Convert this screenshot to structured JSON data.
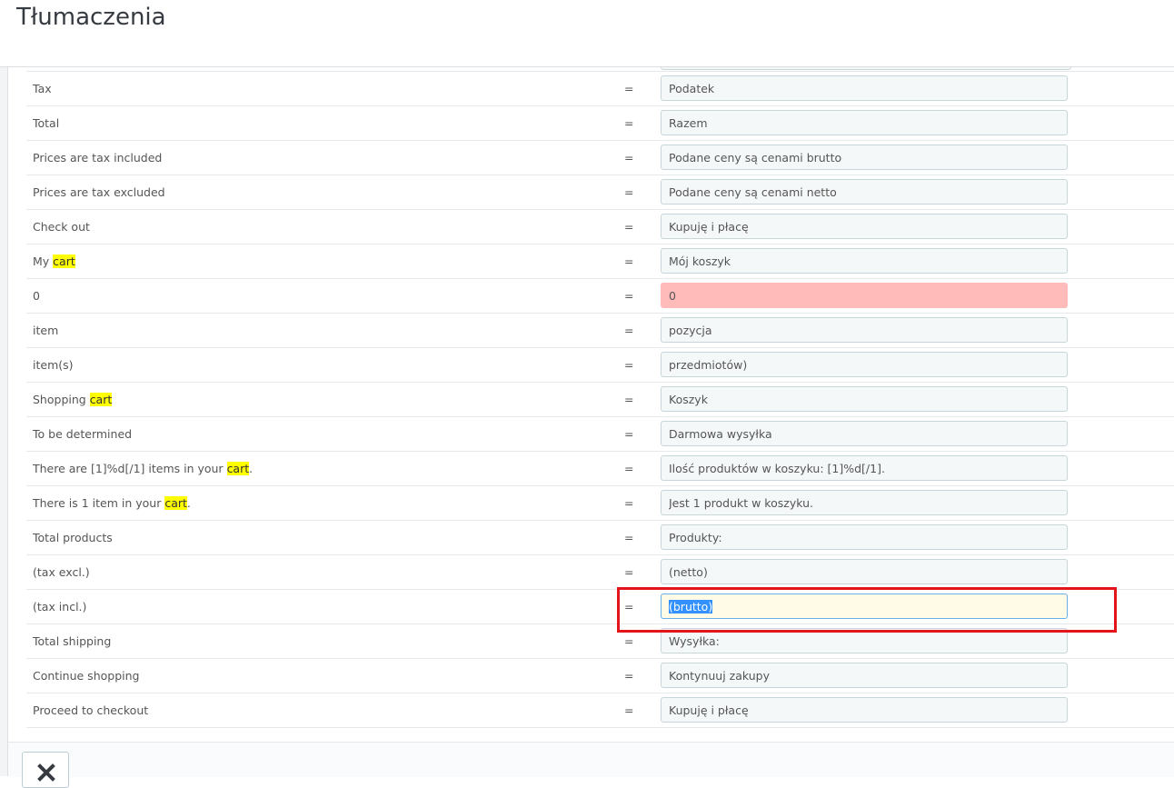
{
  "header": {
    "title": "Tłumaczenia"
  },
  "rows": [
    {
      "source": "Tax",
      "parts": [
        {
          "t": "Tax",
          "h": false
        }
      ],
      "translation": "Podatek",
      "state": "normal"
    },
    {
      "parts": [
        {
          "t": "Total",
          "h": false
        }
      ],
      "translation": "Razem",
      "state": "normal"
    },
    {
      "parts": [
        {
          "t": "Prices are tax included",
          "h": false
        }
      ],
      "translation": "Podane ceny są cenami brutto",
      "state": "normal"
    },
    {
      "parts": [
        {
          "t": "Prices are tax excluded",
          "h": false
        }
      ],
      "translation": "Podane ceny są cenami netto",
      "state": "normal"
    },
    {
      "parts": [
        {
          "t": "Check out",
          "h": false
        }
      ],
      "translation": "Kupuję i płacę",
      "state": "normal"
    },
    {
      "parts": [
        {
          "t": "My ",
          "h": false
        },
        {
          "t": "cart",
          "h": true
        }
      ],
      "translation": "Mój koszyk",
      "state": "normal"
    },
    {
      "parts": [
        {
          "t": "0",
          "h": false
        }
      ],
      "translation": "0",
      "state": "error"
    },
    {
      "parts": [
        {
          "t": "item",
          "h": false
        }
      ],
      "translation": "pozycja",
      "state": "normal"
    },
    {
      "parts": [
        {
          "t": "item(s)",
          "h": false
        }
      ],
      "translation": "przedmiotów)",
      "state": "normal"
    },
    {
      "parts": [
        {
          "t": "Shopping ",
          "h": false
        },
        {
          "t": "cart",
          "h": true
        }
      ],
      "translation": "Koszyk",
      "state": "normal"
    },
    {
      "parts": [
        {
          "t": "To be determined",
          "h": false
        }
      ],
      "translation": "Darmowa wysyłka",
      "state": "normal"
    },
    {
      "parts": [
        {
          "t": "There are [1]%d[/1] items in your ",
          "h": false
        },
        {
          "t": "cart",
          "h": true
        },
        {
          "t": ".",
          "h": false
        }
      ],
      "translation": "Ilość produktów w koszyku: [1]%d[/1].",
      "state": "normal"
    },
    {
      "parts": [
        {
          "t": "There is 1 item in your ",
          "h": false
        },
        {
          "t": "cart",
          "h": true
        },
        {
          "t": ".",
          "h": false
        }
      ],
      "translation": "Jest 1 produkt w koszyku.",
      "state": "normal"
    },
    {
      "parts": [
        {
          "t": "Total products",
          "h": false
        }
      ],
      "translation": "Produkty:",
      "state": "normal"
    },
    {
      "parts": [
        {
          "t": "(tax excl.)",
          "h": false
        }
      ],
      "translation": "(netto)",
      "state": "normal"
    },
    {
      "parts": [
        {
          "t": "(tax incl.)",
          "h": false
        }
      ],
      "translation": "(brutto)",
      "state": "focused"
    },
    {
      "parts": [
        {
          "t": "Total shipping",
          "h": false
        }
      ],
      "translation": "Wysyłka:",
      "state": "normal"
    },
    {
      "parts": [
        {
          "t": "Continue shopping",
          "h": false
        }
      ],
      "translation": "Kontynuuj zakupy",
      "state": "normal"
    },
    {
      "parts": [
        {
          "t": "Proceed to checkout",
          "h": false
        }
      ],
      "translation": "Kupuję i płacę",
      "state": "normal"
    }
  ],
  "separator": "=",
  "icons": {
    "close": "close-icon"
  },
  "colors": {
    "highlight": "#ffff00",
    "error_field": "#ffbaba",
    "focused_field": "#fffbe6",
    "focus_box": "#e3151a"
  }
}
